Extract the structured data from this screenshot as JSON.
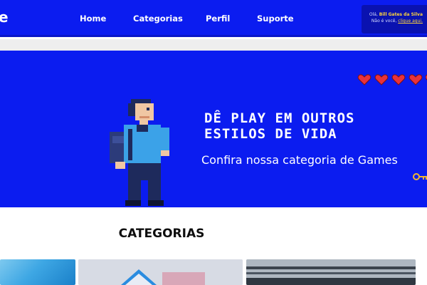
{
  "header": {
    "logo_text": "e",
    "nav": [
      {
        "label": "Home"
      },
      {
        "label": "Categorias"
      },
      {
        "label": "Perfil"
      },
      {
        "label": "Suporte"
      }
    ],
    "user": {
      "greeting": "Olá, ",
      "name": "Bill Gates da Silva",
      "not_you": "Não é você, ",
      "click_here": "clique aqui."
    }
  },
  "hero": {
    "title_line1": "DÊ PLAY EM OUTROS",
    "title_line2": "ESTILOS DE VIDA",
    "subtitle": "Confira nossa categoria de Games",
    "hearts_count": 5,
    "colors": {
      "background": "#0b1cf0",
      "heart": "#e8323b",
      "key": "#f2b531"
    }
  },
  "categories": {
    "title": "CATEGORIAS"
  }
}
